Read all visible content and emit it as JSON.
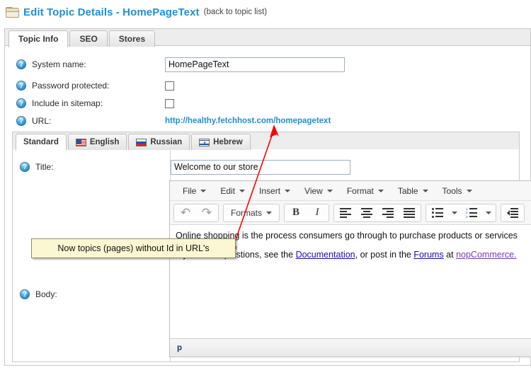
{
  "header": {
    "icon": "folder-icon",
    "title": "Edit Topic Details - HomePageText",
    "back_link": "(back to topic list)"
  },
  "tabs": [
    {
      "label": "Topic Info",
      "active": true
    },
    {
      "label": "SEO",
      "active": false
    },
    {
      "label": "Stores",
      "active": false
    }
  ],
  "form": {
    "system_name": {
      "label": "System name:",
      "value": "HomePageText"
    },
    "password_protected": {
      "label": "Password protected:",
      "checked": false
    },
    "include_in_sitemap": {
      "label": "Include in sitemap:",
      "checked": false
    },
    "url": {
      "label": "URL:",
      "value": "http://healthy.fetchhost.com/homepagetext"
    }
  },
  "locale_tabs": [
    {
      "label": "Standard",
      "flag": "",
      "active": true
    },
    {
      "label": "English",
      "flag": "flag-us",
      "active": false
    },
    {
      "label": "Russian",
      "flag": "flag-ru",
      "active": false
    },
    {
      "label": "Hebrew",
      "flag": "flag-il",
      "active": false
    }
  ],
  "locale_form": {
    "title": {
      "label": "Title:",
      "value": "Welcome to our store"
    },
    "body": {
      "label": "Body:"
    }
  },
  "editor": {
    "menus": [
      "File",
      "Edit",
      "Insert",
      "View",
      "Format",
      "Table",
      "Tools"
    ],
    "toolbar": {
      "undo": "undo-icon",
      "redo": "redo-icon",
      "formats": "Formats",
      "bold": "B",
      "italic": "I",
      "align_left": "align-left-icon",
      "align_center": "align-center-icon",
      "align_right": "align-right-icon",
      "align_justify": "align-justify-icon",
      "bullet_list": "bullet-list-icon",
      "numbered_list": "numbered-list-icon",
      "outdent": "outdent-icon"
    },
    "content": {
      "paragraph1": "Online shopping is the process consumers go through to purchase products or services",
      "paragraph2_pre": "If you have questions, see the ",
      "paragraph2_link1": "Documentation",
      "paragraph2_mid": ", or post in the ",
      "paragraph2_link2": "Forums",
      "paragraph2_mid2": " at ",
      "paragraph2_link3": "nopCommerce."
    },
    "statusbar": "p"
  },
  "annotation": {
    "callout_text": "Now topics (pages) without Id in URL's",
    "accent_color": "#ff0000",
    "callout_bg": "#fbf7d2"
  }
}
